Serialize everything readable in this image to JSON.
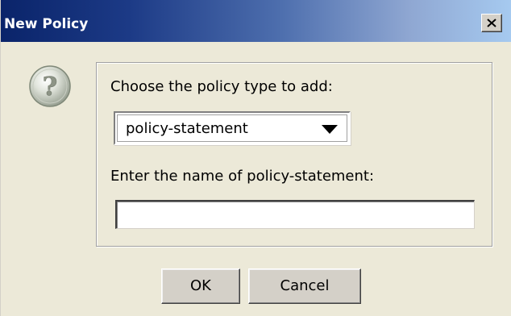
{
  "window": {
    "title": "New Policy",
    "close_label": "×"
  },
  "dialog": {
    "icon": "question-mark-icon",
    "type_prompt": "Choose the policy type to add:",
    "type_select": {
      "selected": "policy-statement"
    },
    "name_prompt": "Enter the name of policy-statement:",
    "name_field": {
      "value": "",
      "placeholder": ""
    }
  },
  "buttons": {
    "ok_label": "OK",
    "cancel_label": "Cancel"
  },
  "colors": {
    "title_gradient_start": "#0a246a",
    "title_gradient_end": "#a6caf0",
    "face": "#ece9d8",
    "button_face": "#d4d0c8"
  }
}
